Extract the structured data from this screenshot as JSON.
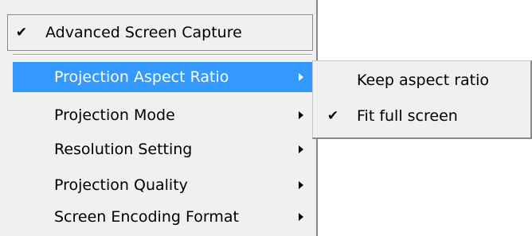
{
  "menu": {
    "advanced_capture": {
      "checked": true,
      "check_mark": "✔",
      "label": "Advanced Screen Capture"
    },
    "items": [
      {
        "label": "Projection Aspect Ratio",
        "has_submenu": true,
        "highlighted": true
      },
      {
        "label": "Projection Mode",
        "has_submenu": true,
        "highlighted": false
      },
      {
        "label": "Resolution Setting",
        "has_submenu": true,
        "highlighted": false
      },
      {
        "label": "Projection Quality",
        "has_submenu": true,
        "highlighted": false
      },
      {
        "label": "Screen Encoding Format",
        "has_submenu": true,
        "highlighted": false
      }
    ]
  },
  "submenu": {
    "items": [
      {
        "label": "Keep aspect ratio",
        "checked": false,
        "check_mark": ""
      },
      {
        "label": "Fit full screen",
        "checked": true,
        "check_mark": "✔"
      }
    ]
  },
  "colors": {
    "menu_background": "#f0f0f0",
    "highlight": "#3399ff",
    "highlight_text": "#ffffff",
    "border_dark": "#8a8a8a"
  }
}
